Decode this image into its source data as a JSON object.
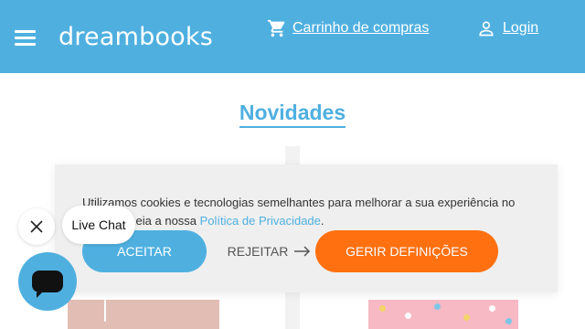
{
  "header": {
    "brand": "dreambooks",
    "cart_label": "Carrinho de compras",
    "login_label": "Login",
    "background_color": "#4fb0e0"
  },
  "main": {
    "section_title": "Novidades"
  },
  "cookie_banner": {
    "text_before_link": "Utilizamos cookies e tecnologias semelhantes para melhorar a sua experiência no website. Leia a nossa ",
    "privacy_link_label": "Política de Privacidade",
    "text_after_link": ".",
    "accept_label": "ACEITAR",
    "reject_label": "REJEITAR",
    "settings_label": "GERIR DEFINIÇÕES",
    "accept_color": "#4fb0e0",
    "settings_color": "#ff7010"
  },
  "live_chat": {
    "bubble_label": "Live Chat"
  },
  "icons": {
    "menu": "hamburger-menu-icon",
    "cart": "shopping-cart-icon",
    "user": "user-icon",
    "arrow": "arrow-right-icon",
    "close": "close-icon",
    "chat": "chat-icon"
  }
}
